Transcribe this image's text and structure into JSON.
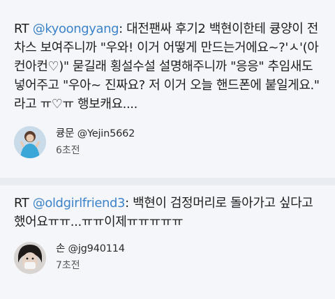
{
  "tweets": [
    {
      "rt": "RT",
      "mention": "@kyoongyang",
      "body": ": 대전팬싸 후기2 백현이한테 큥양이 전차스 보여주니까 \"우와! 이거 어떻게 만드는거에요~?'ㅅ'(아컨아컨♡)\" 묻길래 횡설수설 설명해주니까 \"응응\" 추임새도 넣어주고 \"우아~ 진짜요? 저 이거 오늘 핸드폰에 붙일게요.\" 라고 ㅠ♡ㅠ 행보캐요....",
      "user": "큥문 @Yejin5662",
      "time": "6초전"
    },
    {
      "rt": "RT",
      "mention": "@oldgirlfriend3",
      "body": ": 백현이 검정머리로 돌아가고 싶다고 했어요ㅠㅠ...ㅠㅠ이제ㅠㅠㅠㅠㅠ",
      "user": "손 @jg940114",
      "time": "7초전"
    }
  ],
  "colors": {
    "mention": "#3c83c9",
    "card_bg": "#f4f6f9",
    "page_bg": "#e9edf1"
  }
}
